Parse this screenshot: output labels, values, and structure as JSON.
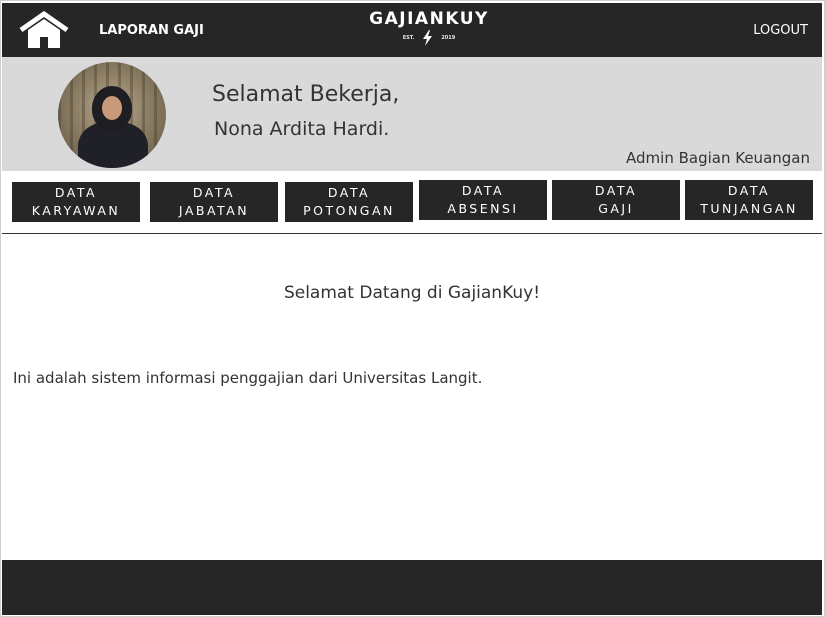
{
  "header": {
    "home_icon": "house-icon",
    "laporan_label": "LAPORAN GAJI",
    "brand_title": "GAJIANKUY",
    "brand_est": "EST.",
    "brand_year": "2019",
    "brand_icon": "lightning-bolt-icon",
    "logout_label": "LOGOUT"
  },
  "profile": {
    "greeting": "Selamat Bekerja,",
    "name": "Nona Ardita Hardi.",
    "role": "Admin Bagian Keuangan"
  },
  "menu": [
    {
      "line1": "DATA",
      "line2": "KARYAWAN"
    },
    {
      "line1": "DATA",
      "line2": "JABATAN"
    },
    {
      "line1": "DATA",
      "line2": "POTONGAN"
    },
    {
      "line1": "DATA",
      "line2": "ABSENSI"
    },
    {
      "line1": "DATA",
      "line2": "GAJI"
    },
    {
      "line1": "DATA",
      "line2": "TUNJANGAN"
    }
  ],
  "content": {
    "welcome": "Selamat Datang di GajianKuy!",
    "description": "Ini adalah sistem informasi penggajian dari Universitas Langit."
  },
  "colors": {
    "dark": "#262626",
    "band": "#d9d9d9",
    "text": "#333333"
  }
}
